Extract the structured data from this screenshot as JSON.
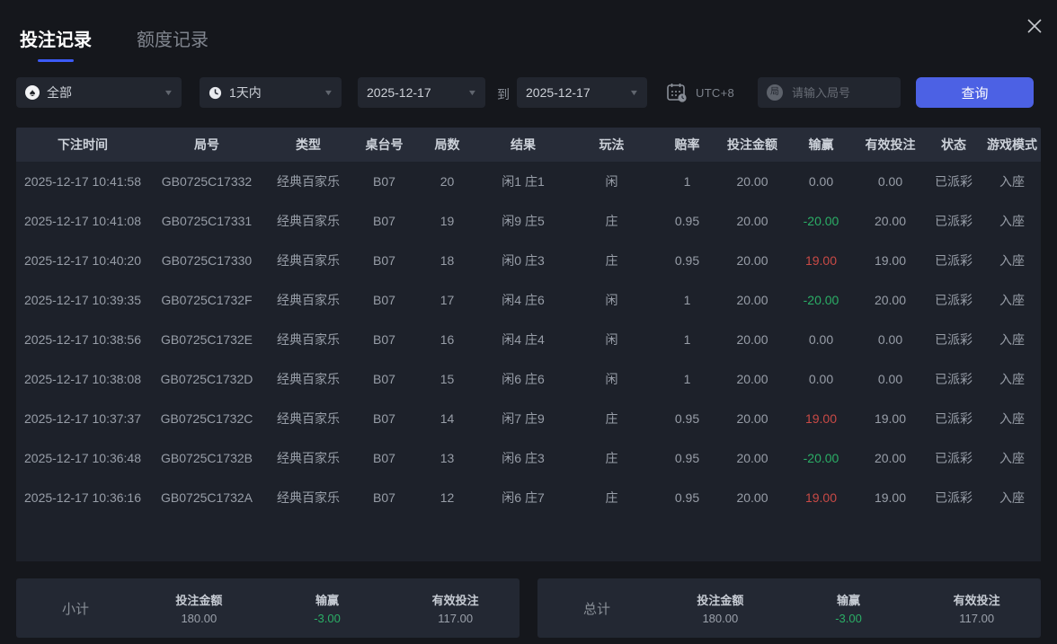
{
  "window": {
    "close_icon": "x"
  },
  "tabs": [
    {
      "label": "投注记录",
      "active": true
    },
    {
      "label": "额度记录",
      "active": false
    }
  ],
  "filters": {
    "game_type": {
      "value": "全部",
      "icon": "spade-icon"
    },
    "time_range": {
      "value": "1天内",
      "icon": "clock-icon"
    },
    "date_from": "2025-12-17",
    "to_label": "到",
    "date_to": "2025-12-17",
    "timezone_label": "UTC+8",
    "round_input": {
      "placeholder": "请输入局号",
      "icon_char": "局"
    },
    "query_button_label": "查询"
  },
  "table": {
    "columns": [
      "下注时间",
      "局号",
      "类型",
      "桌台号",
      "局数",
      "结果",
      "玩法",
      "赔率",
      "投注金额",
      "输赢",
      "有效投注",
      "状态",
      "游戏模式"
    ],
    "rows": [
      {
        "time": "2025-12-17 10:41:58",
        "round": "GB0725C17332",
        "type": "经典百家乐",
        "table_no": "B07",
        "count": "20",
        "result": "闲1 庄1",
        "play": "闲",
        "odds": "1",
        "amount": "20.00",
        "winloss": "0.00",
        "winloss_color": "gray",
        "valid": "0.00",
        "status": "已派彩",
        "mode": "入座"
      },
      {
        "time": "2025-12-17 10:41:08",
        "round": "GB0725C17331",
        "type": "经典百家乐",
        "table_no": "B07",
        "count": "19",
        "result": "闲9 庄5",
        "play": "庄",
        "odds": "0.95",
        "amount": "20.00",
        "winloss": "-20.00",
        "winloss_color": "green",
        "valid": "20.00",
        "status": "已派彩",
        "mode": "入座"
      },
      {
        "time": "2025-12-17 10:40:20",
        "round": "GB0725C17330",
        "type": "经典百家乐",
        "table_no": "B07",
        "count": "18",
        "result": "闲0 庄3",
        "play": "庄",
        "odds": "0.95",
        "amount": "20.00",
        "winloss": "19.00",
        "winloss_color": "red",
        "valid": "19.00",
        "status": "已派彩",
        "mode": "入座"
      },
      {
        "time": "2025-12-17 10:39:35",
        "round": "GB0725C1732F",
        "type": "经典百家乐",
        "table_no": "B07",
        "count": "17",
        "result": "闲4 庄6",
        "play": "闲",
        "odds": "1",
        "amount": "20.00",
        "winloss": "-20.00",
        "winloss_color": "green",
        "valid": "20.00",
        "status": "已派彩",
        "mode": "入座"
      },
      {
        "time": "2025-12-17 10:38:56",
        "round": "GB0725C1732E",
        "type": "经典百家乐",
        "table_no": "B07",
        "count": "16",
        "result": "闲4 庄4",
        "play": "闲",
        "odds": "1",
        "amount": "20.00",
        "winloss": "0.00",
        "winloss_color": "gray",
        "valid": "0.00",
        "status": "已派彩",
        "mode": "入座"
      },
      {
        "time": "2025-12-17 10:38:08",
        "round": "GB0725C1732D",
        "type": "经典百家乐",
        "table_no": "B07",
        "count": "15",
        "result": "闲6 庄6",
        "play": "闲",
        "odds": "1",
        "amount": "20.00",
        "winloss": "0.00",
        "winloss_color": "gray",
        "valid": "0.00",
        "status": "已派彩",
        "mode": "入座"
      },
      {
        "time": "2025-12-17 10:37:37",
        "round": "GB0725C1732C",
        "type": "经典百家乐",
        "table_no": "B07",
        "count": "14",
        "result": "闲7 庄9",
        "play": "庄",
        "odds": "0.95",
        "amount": "20.00",
        "winloss": "19.00",
        "winloss_color": "red",
        "valid": "19.00",
        "status": "已派彩",
        "mode": "入座"
      },
      {
        "time": "2025-12-17 10:36:48",
        "round": "GB0725C1732B",
        "type": "经典百家乐",
        "table_no": "B07",
        "count": "13",
        "result": "闲6 庄3",
        "play": "庄",
        "odds": "0.95",
        "amount": "20.00",
        "winloss": "-20.00",
        "winloss_color": "green",
        "valid": "20.00",
        "status": "已派彩",
        "mode": "入座"
      },
      {
        "time": "2025-12-17 10:36:16",
        "round": "GB0725C1732A",
        "type": "经典百家乐",
        "table_no": "B07",
        "count": "12",
        "result": "闲6 庄7",
        "play": "庄",
        "odds": "0.95",
        "amount": "20.00",
        "winloss": "19.00",
        "winloss_color": "red",
        "valid": "19.00",
        "status": "已派彩",
        "mode": "入座"
      }
    ]
  },
  "summary": {
    "subtotal": {
      "label": "小计",
      "items": [
        {
          "label": "投注金额",
          "value": "180.00",
          "color": "gray"
        },
        {
          "label": "输赢",
          "value": "-3.00",
          "color": "green"
        },
        {
          "label": "有效投注",
          "value": "117.00",
          "color": "gray"
        }
      ]
    },
    "total": {
      "label": "总计",
      "items": [
        {
          "label": "投注金额",
          "value": "180.00",
          "color": "gray"
        },
        {
          "label": "输赢",
          "value": "-3.00",
          "color": "green"
        },
        {
          "label": "有效投注",
          "value": "117.00",
          "color": "gray"
        }
      ]
    }
  },
  "colors": {
    "accent_blue": "#4c61e4",
    "tab_underline": "#3c5bf6",
    "win_red": "#c94a46",
    "loss_green": "#2bae66",
    "page_bg": "#15171c",
    "table_header_bg": "#272c38",
    "table_body_bg": "#1d212a",
    "summary_bg": "#232833"
  }
}
